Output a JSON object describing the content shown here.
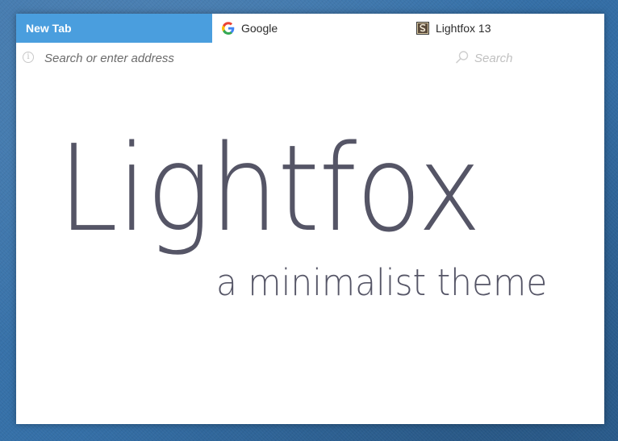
{
  "tabs": [
    {
      "label": "New Tab",
      "icon": "none",
      "active": true
    },
    {
      "label": "Google",
      "icon": "google-icon",
      "active": false
    },
    {
      "label": "Lightfox 13",
      "icon": "lightfox-favicon-icon",
      "active": false
    }
  ],
  "navbar": {
    "info_icon": "info-icon",
    "url_placeholder": "Search or enter address",
    "url_value": "",
    "search_icon": "search-icon",
    "search_placeholder": "Search",
    "search_value": ""
  },
  "page": {
    "title": "Lightfox",
    "subtitle": "a minimalist theme"
  },
  "colors": {
    "active_tab": "#4a9ede",
    "hero_text": "#555566",
    "desktop_background": "#3570a8"
  }
}
